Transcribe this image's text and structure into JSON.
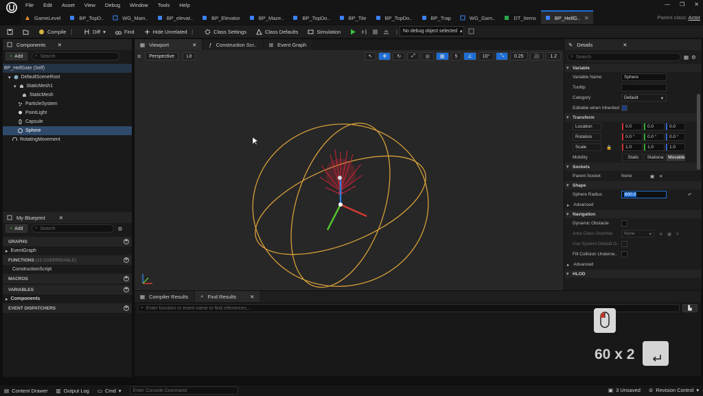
{
  "menu": [
    "File",
    "Edit",
    "Asset",
    "View",
    "Debug",
    "Window",
    "Tools",
    "Help"
  ],
  "tabs": [
    {
      "label": "GameLevel",
      "icon": "level-icon"
    },
    {
      "label": "BP_TopD..",
      "icon": "blueprint-icon"
    },
    {
      "label": "WG_Main..",
      "icon": "widget-icon"
    },
    {
      "label": "BP_elevat..",
      "icon": "blueprint-icon"
    },
    {
      "label": "BP_Elevator",
      "icon": "blueprint-icon"
    },
    {
      "label": "BP_Maze..",
      "icon": "blueprint-icon"
    },
    {
      "label": "BP_TopDo..",
      "icon": "blueprint-icon"
    },
    {
      "label": "BP_Tile",
      "icon": "blueprint-icon"
    },
    {
      "label": "BP_TopDo..",
      "icon": "blueprint-icon"
    },
    {
      "label": "BP_Trap",
      "icon": "blueprint-icon"
    },
    {
      "label": "WG_Gam..",
      "icon": "widget-icon"
    },
    {
      "label": "DT_Items",
      "icon": "datatable-icon"
    },
    {
      "label": "BP_HellG..",
      "icon": "blueprint-icon",
      "active": true
    }
  ],
  "parent_class": {
    "label": "Parent class:",
    "value": "Actor"
  },
  "toolbar": {
    "compile": "Compile",
    "diff": "Diff",
    "find": "Find",
    "hide_unrelated": "Hide Unrelated",
    "class_settings": "Class Settings",
    "class_defaults": "Class Defaults",
    "simulation": "Simulation",
    "debug_object": "No debug object selected"
  },
  "components": {
    "tab": "Components",
    "add": "Add",
    "search_placeholder": "Search",
    "root": "BP_HellGate (Self)",
    "items": [
      {
        "label": "DefaultSceneRoot",
        "icon": "scene-root-icon"
      },
      {
        "label": "StaticMesh1",
        "icon": "static-mesh-icon"
      },
      {
        "label": "StaticMesh",
        "icon": "static-mesh-icon"
      },
      {
        "label": "ParticleSystem",
        "icon": "particle-icon"
      },
      {
        "label": "PointLight",
        "icon": "light-icon"
      },
      {
        "label": "Capsule",
        "icon": "capsule-icon"
      },
      {
        "label": "Sphere",
        "icon": "sphere-icon",
        "selected": true
      },
      {
        "label": "RotatingMovement",
        "icon": "movement-icon"
      }
    ]
  },
  "my_blueprint": {
    "tab": "My Blueprint",
    "add": "Add",
    "search_placeholder": "Search",
    "graphs": "GRAPHS",
    "event_graph": "EventGraph",
    "functions": "FUNCTIONS",
    "functions_count": "(15 OVERRIDABLE)",
    "construction_script": "ConstructionScript",
    "macros": "MACROS",
    "variables": "VARIABLES",
    "components_cat": "Components",
    "event_dispatchers": "EVENT DISPATCHERS"
  },
  "viewport_tabs": [
    "Viewport",
    "Construction Scr..",
    "Event Graph"
  ],
  "viewport": {
    "perspective": "Perspective",
    "lit": "Lit",
    "grid_snap": "5",
    "rot_snap": "10°",
    "scale_snap": "0.25",
    "cam_speed": "1.2"
  },
  "details": {
    "tab": "Details",
    "search_placeholder": "Search",
    "variable": "Variable",
    "variable_name_label": "Variable Name",
    "variable_name": "Sphere",
    "tooltip_label": "Tooltip",
    "category_label": "Category",
    "category": "Default",
    "editable_label": "Editable when Inherited",
    "transform": "Transform",
    "location": "Location",
    "rotation": "Rotation",
    "scale": "Scale",
    "loc": [
      "0.0",
      "0.0",
      "0.0"
    ],
    "rot": [
      "0.0 °",
      "0.0 °",
      "0.0 °"
    ],
    "scl": [
      "1.0",
      "1.0",
      "1.0"
    ],
    "mobility_label": "Mobility",
    "mobility": [
      "Static",
      "Stationa",
      "Movable"
    ],
    "sockets": "Sockets",
    "parent_socket_label": "Parent Socket",
    "parent_socket": "None",
    "shape": "Shape",
    "sphere_radius_label": "Sphere Radius",
    "sphere_radius": "600.0",
    "advanced": "Advanced",
    "navigation": "Navigation",
    "dynamic_obstacle_label": "Dynamic Obstacle",
    "area_class_label": "Area Class Override",
    "area_class": "None",
    "use_system_label": "Use System Default O..",
    "fill_collision_label": "Fill Collision Underne..",
    "advanced2": "Advanced",
    "hlod": "HLOD"
  },
  "bottom": {
    "tabs": [
      "Compiler Results",
      "Find Results"
    ],
    "find_placeholder": "Enter function or event name to find references..."
  },
  "overlay": {
    "text": "60 x 2"
  },
  "status": {
    "content_drawer": "Content Drawer",
    "output_log": "Output Log",
    "cmd": "Cmd",
    "console_placeholder": "Enter Console Command",
    "unsaved": "3 Unsaved",
    "revision": "Revision Control"
  },
  "colors": {
    "accent": "#1f6fd6",
    "selection": "#2f4a6b",
    "gizmo_ring": "#d9a13a",
    "particles": "#e0233a"
  }
}
